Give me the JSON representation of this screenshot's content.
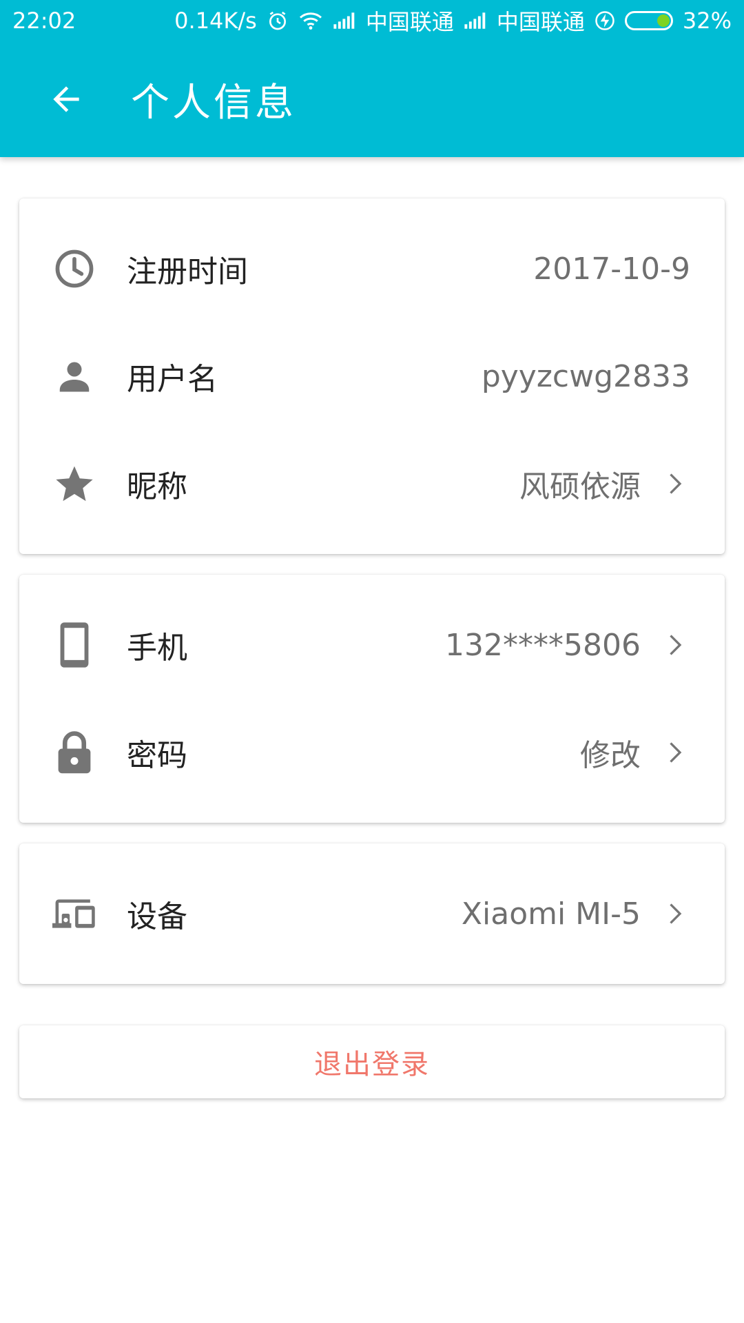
{
  "status_bar": {
    "time": "22:02",
    "net_speed": "0.14K/s",
    "carrier1": "中国联通",
    "carrier2": "中国联通",
    "battery": "32%"
  },
  "toolbar": {
    "title": "个人信息"
  },
  "card1": {
    "register_label": "注册时间",
    "register_value": "2017-10-9",
    "username_label": "用户名",
    "username_value": "pyyzcwg2833",
    "nickname_label": "昵称",
    "nickname_value": "风硕依源"
  },
  "card2": {
    "phone_label": "手机",
    "phone_value": "132****5806",
    "password_label": "密码",
    "password_value": "修改"
  },
  "card3": {
    "device_label": "设备",
    "device_value": "Xiaomi MI-5"
  },
  "logout_label": "退出登录",
  "colors": {
    "app_bar": "#00bcd4",
    "logout_text": "#f0776b",
    "icon_gray": "#757575"
  }
}
